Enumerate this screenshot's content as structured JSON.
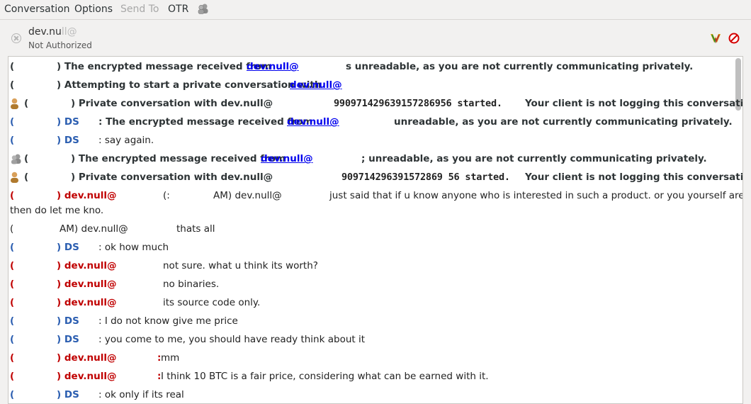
{
  "menu": {
    "items": [
      "Conversation",
      "Options",
      "Send To",
      "OTR"
    ],
    "disabled_index": 2
  },
  "header": {
    "name_visible": "dev.nu",
    "name_blur": "ll@",
    "status": "Not Authorized",
    "icons": [
      "verified-icon",
      "block-icon"
    ]
  },
  "messages": {
    "m1": {
      "a": "(",
      "b": ") The encrypted message received from ",
      "link": "dev.null@",
      "c": "s unreadable, as you are not currently communicating privately."
    },
    "m2": {
      "a": "(",
      "b": ") Attempting to start a private conversation with ",
      "link": "dev.null@"
    },
    "m3": {
      "a": "(",
      "b": ") Private conversation with dev.null@",
      "fp": "990971429639157286956 started.",
      "c": "  Your client is not logging this conversation."
    },
    "m4": {
      "a": "(",
      "b": ") DS",
      "c": ": The encrypted message received from ",
      "link": "dev.null@",
      "d": "unreadable, as you are not currently communicating privately."
    },
    "m5": {
      "a": "(",
      "b": ") DS",
      "c": ": say again."
    },
    "m6": {
      "a": "(",
      "b": ") The encrypted message received from ",
      "link": "dev.null@",
      "c": "; unreadable, as you are not currently communicating privately."
    },
    "m7": {
      "a": "(",
      "b": ") Private conversation with dev.null@",
      "fp": "909714296391572869 56 started.",
      "c": "  Your client is not logging this conversation."
    },
    "m8": {
      "a": "(",
      "b": ") dev.null@",
      "c": "(:",
      "d": "AM) dev.null@",
      "e": "just said that if u know anyone who is interested in such a product. or you yourself are"
    },
    "m8b": "then do let me kno.",
    "m9": {
      "a": "(",
      "b": "AM) dev.null@",
      "c": "thats all"
    },
    "m10": {
      "a": "(",
      "b": ") DS",
      "c": ": ok how much"
    },
    "m11": {
      "a": "(",
      "b": ") dev.null@",
      "c": "not sure. what u think its worth?"
    },
    "m12": {
      "a": "(",
      "b": ") dev.null@",
      "c": "no binaries."
    },
    "m13": {
      "a": "(",
      "b": ") dev.null@",
      "c": "its source code only."
    },
    "m14": {
      "a": "(",
      "b": ") DS",
      "c": ": I do not know give me price"
    },
    "m15": {
      "a": "(",
      "b": ") DS",
      "c": ": you come to me, you should have ready think about it"
    },
    "m16": {
      "a": "(",
      "b": ") dev.null@",
      "colon": ":",
      "c": " mm"
    },
    "m17": {
      "a": "(",
      "b": ") dev.null@",
      "colon": ":",
      "c": " I think 10 BTC is a fair price, considering what can be earned with it."
    },
    "m18": {
      "a": "(",
      "b": ") DS",
      "c": ": ok only if its real"
    }
  },
  "colors": {
    "local": "#2a5db0",
    "remote": "#c00000",
    "link": "#0000ee"
  }
}
